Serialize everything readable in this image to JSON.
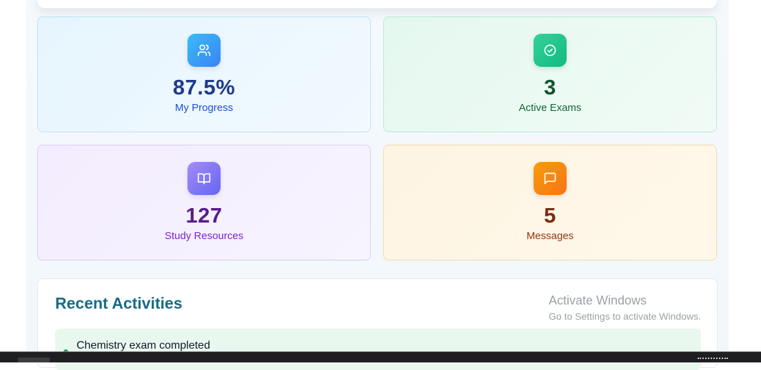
{
  "stats": [
    {
      "value": "87.5%",
      "label": "My Progress",
      "icon": "users-icon",
      "accent": "#3b82f6"
    },
    {
      "value": "3",
      "label": "Active Exams",
      "icon": "check-circle-icon",
      "accent": "#10b981"
    },
    {
      "value": "127",
      "label": "Study Resources",
      "icon": "book-open-icon",
      "accent": "#8b5cf6"
    },
    {
      "value": "5",
      "label": "Messages",
      "icon": "message-square-icon",
      "accent": "#f59e0b"
    }
  ],
  "activities": {
    "title": "Recent Activities",
    "items": [
      {
        "text": "Chemistry exam completed"
      }
    ]
  },
  "windows_watermark": {
    "title": "Activate Windows",
    "subtitle": "Go to Settings to activate Windows."
  }
}
